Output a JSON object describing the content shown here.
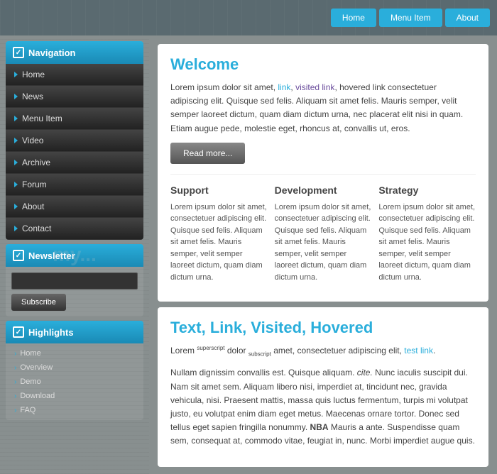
{
  "topnav": {
    "buttons": [
      "Home",
      "Menu Item",
      "About"
    ]
  },
  "sidebar": {
    "navigation": {
      "label": "Navigation",
      "items": [
        "Home",
        "News",
        "Menu Item",
        "Video",
        "Archive",
        "Forum",
        "About",
        "Contact"
      ]
    },
    "newsletter": {
      "label": "Newsletter",
      "input_placeholder": "",
      "subscribe_label": "Subscribe"
    },
    "highlights": {
      "label": "Highlights",
      "items": [
        "Home",
        "Overview",
        "Demo",
        "Download",
        "FAQ"
      ]
    }
  },
  "main": {
    "welcome": {
      "title": "Welcome",
      "body": "Lorem ipsum dolor sit amet, link, visited link, hovered link consectetuer adipiscing elit. Quisque sed felis. Aliquam sit amet felis. Mauris semper, velit semper laoreet dictum, quam diam dictum urna, nec placerat elit nisi in quam. Etiam augue pede, molestie eget, rhoncus at, convallis ut, eros.",
      "read_more": "Read more...",
      "columns": [
        {
          "title": "Support",
          "body": "Lorem ipsum dolor sit amet, consectetuer adipiscing elit. Quisque sed felis. Aliquam sit amet felis. Mauris semper, velit semper laoreet dictum, quam diam dictum urna."
        },
        {
          "title": "Development",
          "body": "Lorem ipsum dolor sit amet, consectetuer adipiscing elit. Quisque sed felis. Aliquam sit amet felis. Mauris semper, velit semper laoreet dictum, quam diam dictum urna."
        },
        {
          "title": "Strategy",
          "body": "Lorem ipsum dolor sit amet, consectetuer adipiscing elit. Quisque sed felis. Aliquam sit amet felis. Mauris semper, velit semper laoreet dictum, quam diam dictum urna."
        }
      ]
    },
    "textlink": {
      "title_prefix": "Text, ",
      "title_link": "Link",
      "title_suffix": ", Visited, Hovered",
      "para1_before_sup": "Lorem ",
      "para1_sup": "superscript",
      "para1_mid": " dolor ",
      "para1_sub": "subscript",
      "para1_after": " amet, consectetuer adipiscing elit, ",
      "para1_link": "test link",
      "para1_end": ".",
      "para2": "Nullam dignissim convallis est. Quisque aliquam. cite. Nunc iaculis suscipit dui. Nam sit amet sem. Aliquam libero nisi, imperdiet at, tincidunt nec, gravida vehicula, nisi. Praesent mattis, massa quis luctus fermentum, turpis mi volutpat justo, eu volutpat enim diam eget metus. Maecenas ornare tortor. Donec sed tellus eget sapien fringilla nonummy. NBA Mauris a ante. Suspendisse quam sem, consequat at, commodo vitae, feugiat in, nunc. Morbi imperdiet augue quis."
    }
  }
}
